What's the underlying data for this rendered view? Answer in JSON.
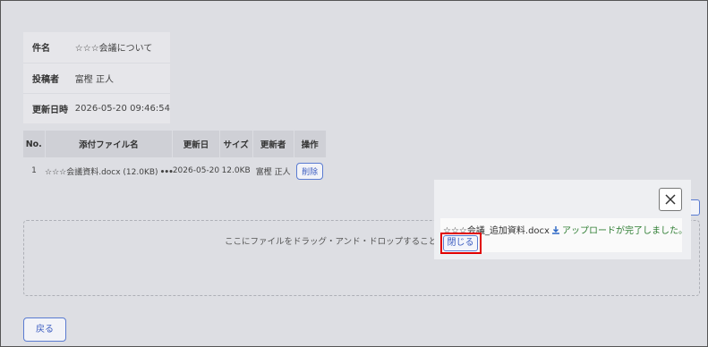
{
  "info": {
    "subject_label": "件名",
    "subject_value": "☆☆☆会議について",
    "poster_label": "投稿者",
    "poster_value": "富樫 正人",
    "updated_label": "更新日時",
    "updated_value": "2026-05-20 09:46:54"
  },
  "attachments": {
    "headers": {
      "no": "No.",
      "name": "添付ファイル名",
      "date": "更新日",
      "size": "サイズ",
      "user": "更新者",
      "op": "操作"
    },
    "rows": [
      {
        "no": "1",
        "name": "☆☆☆会議資料.docx (12.0KB)",
        "more": "•••",
        "date": "2026-05-20",
        "size": "12.0KB",
        "user": "富樫 正人",
        "delete": "削除"
      }
    ]
  },
  "dropzone": {
    "text": "ここにファイルをドラッグ・アンド・ドロップすることでアッ"
  },
  "back_button": "戻る",
  "popup": {
    "filename": "☆☆☆会議_追加資料.docx",
    "message": "アップロードが完了しました。",
    "close_label": "閉じる"
  },
  "colors": {
    "accent": "#3c5dc0",
    "success": "#2e7d32",
    "highlight": "#e00000"
  },
  "icons": {
    "close": "close-icon",
    "download": "download-icon"
  }
}
